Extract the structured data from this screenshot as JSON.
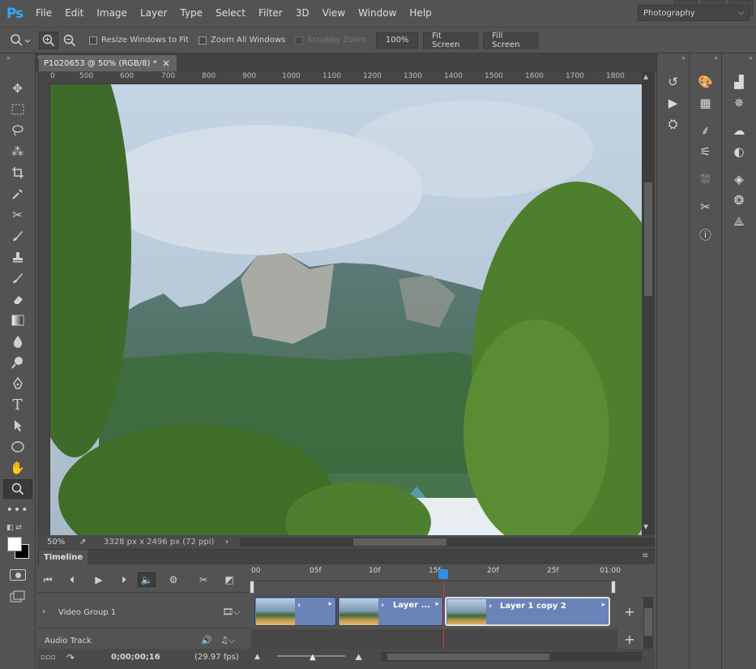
{
  "app": {
    "logo": "Ps"
  },
  "menu": [
    "File",
    "Edit",
    "Image",
    "Layer",
    "Type",
    "Select",
    "Filter",
    "3D",
    "View",
    "Window",
    "Help"
  ],
  "window_controls": {
    "minimize": "▁",
    "restore": "□",
    "close": "✕"
  },
  "options": {
    "resize_windows": "Resize Windows to Fit",
    "zoom_all": "Zoom All Windows",
    "scrubby": "Scrubby Zoom",
    "zoom_level": "100%",
    "fit_screen": "Fit Screen",
    "fill_screen": "Fill Screen",
    "workspace": "Photography"
  },
  "document": {
    "tab_title": "P1020653 @ 50% (RGB/8) *",
    "close": "×",
    "ruler_labels": [
      "0",
      "500",
      "600",
      "700",
      "800",
      "900",
      "1000",
      "1100",
      "1200",
      "1300",
      "1400",
      "1500",
      "1600",
      "1700",
      "1800"
    ],
    "zoom": "50%",
    "doc_info": "3328 px x 2496 px (72 ppi)"
  },
  "timeline": {
    "title": "Timeline",
    "ticks": [
      "00",
      "05f",
      "10f",
      "15f",
      "20f",
      "25f",
      "01:00"
    ],
    "video_group": "Video Group 1",
    "audio_track": "Audio Track",
    "clips": [
      "",
      "Layer ...",
      "Layer 1 copy 2"
    ],
    "timecode": "0;00;00;16",
    "fps": "(29.97 fps)",
    "add": "+"
  },
  "colors": {
    "accent": "#31a8ff",
    "playhead": "#c93a3a",
    "clip": "#6a83b8"
  }
}
